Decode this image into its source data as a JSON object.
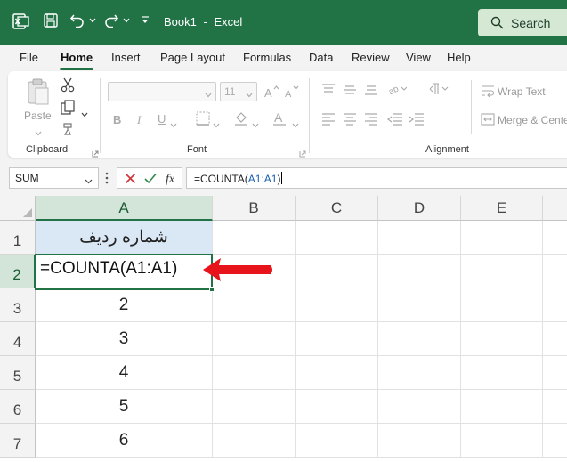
{
  "titlebar": {
    "doc_name": "Book1",
    "separator": "-",
    "app_name": "Excel",
    "search_label": "Search",
    "bg_color": "#217346"
  },
  "menu": {
    "tabs": [
      "File",
      "Home",
      "Insert",
      "Page Layout",
      "Formulas",
      "Data",
      "Review",
      "View",
      "Help"
    ],
    "active": "Home"
  },
  "ribbon": {
    "clipboard": {
      "label": "Clipboard",
      "paste_label": "Paste"
    },
    "font": {
      "label": "Font",
      "font_size": "11"
    },
    "alignment": {
      "label": "Alignment",
      "wrap_text": "Wrap Text",
      "merge_center": "Merge & Center"
    }
  },
  "formula_bar": {
    "name_box": "SUM",
    "formula_prefix": "=COUNTA(",
    "formula_ref": "A1:A1",
    "formula_suffix": ")"
  },
  "grid": {
    "columns": [
      "A",
      "B",
      "C",
      "D",
      "E"
    ],
    "rows": [
      "1",
      "2",
      "3",
      "4",
      "5",
      "6",
      "7"
    ],
    "cells_a": [
      "شماره ردیف",
      "",
      "2",
      "3",
      "4",
      "5",
      "6"
    ],
    "active_formula": "=COUNTA(A1:A1)",
    "accent": "#217346",
    "header_fill": "#dae8f5",
    "arrow_color": "#e8141c"
  }
}
